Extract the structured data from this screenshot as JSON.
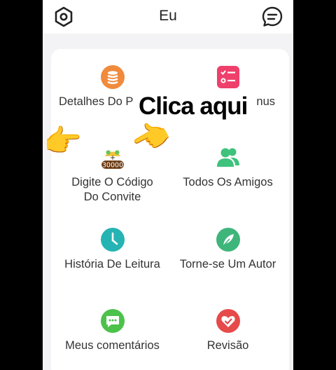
{
  "header": {
    "title": "Eu"
  },
  "grid": {
    "points_details": "Detalhes Do P",
    "points_details_tail": "nus",
    "invite_code": "Digite O Código\nDo Convite",
    "invite_badge": "30000",
    "all_friends": "Todos Os Amigos",
    "reading_history": "História De Leitura",
    "become_author": "Torne-se Um Autor",
    "my_comments": "Meus comentários",
    "review": "Revisão"
  },
  "overlay": {
    "caption": "Clica aqui"
  },
  "colors": {
    "orange": "#f08a3c",
    "pink": "#ef3f6b",
    "green": "#3ec27c",
    "teal": "#26b3b3",
    "red": "#e64a4a",
    "lime": "#4cc24a"
  }
}
